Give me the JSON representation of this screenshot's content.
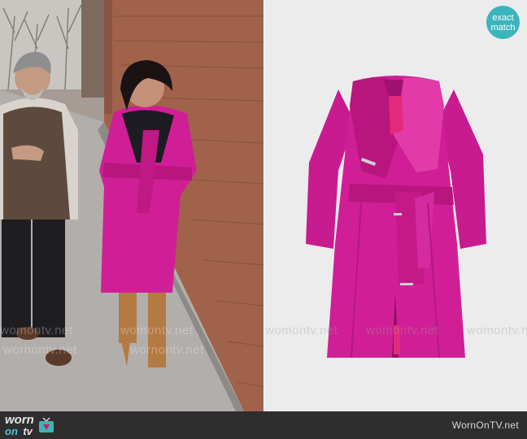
{
  "badge": {
    "line1": "exact",
    "line2": "match"
  },
  "watermarks": {
    "left_1": "womontv.net",
    "left_2": "wornontv.net",
    "right_1": "womontv.net"
  },
  "footer": {
    "logo_worn": "worn",
    "logo_on": "on",
    "logo_tv": "tv",
    "site_url": "WornOnTV.net"
  },
  "colors": {
    "coat_pink": "#d01f96",
    "badge_teal": "#3bb5bd",
    "bar_dark": "#2e2e2e"
  },
  "icons": [
    "tv-icon",
    "exact-match-badge"
  ]
}
